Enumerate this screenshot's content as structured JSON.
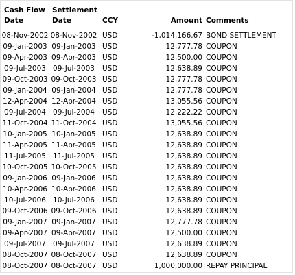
{
  "headers": {
    "cash_flow_date": [
      "Cash Flow",
      "Date"
    ],
    "settlement_date": [
      "Settlement",
      "Date"
    ],
    "ccy": "CCY",
    "amount": "Amount",
    "comments": "Comments"
  },
  "rows": [
    {
      "cf_date": "08-Nov-2002",
      "settle_date": "08-Nov-2002",
      "ccy": "USD",
      "amount": "-1,014,166.67",
      "comment": "BOND SETTLEMENT"
    },
    {
      "cf_date": "09-Jan-2003",
      "settle_date": "09-Jan-2003",
      "ccy": "USD",
      "amount": "12,777.78",
      "comment": "COUPON"
    },
    {
      "cf_date": "09-Apr-2003",
      "settle_date": "09-Apr-2003",
      "ccy": "USD",
      "amount": "12,500.00",
      "comment": "COUPON"
    },
    {
      "cf_date": "09-Jul-2003",
      "settle_date": "09-Jul-2003",
      "ccy": "USD",
      "amount": "12,638.89",
      "comment": "COUPON"
    },
    {
      "cf_date": "09-Oct-2003",
      "settle_date": "09-Oct-2003",
      "ccy": "USD",
      "amount": "12,777.78",
      "comment": "COUPON"
    },
    {
      "cf_date": "09-Jan-2004",
      "settle_date": "09-Jan-2004",
      "ccy": "USD",
      "amount": "12,777.78",
      "comment": "COUPON"
    },
    {
      "cf_date": "12-Apr-2004",
      "settle_date": "12-Apr-2004",
      "ccy": "USD",
      "amount": "13,055.56",
      "comment": "COUPON"
    },
    {
      "cf_date": "09-Jul-2004",
      "settle_date": "09-Jul-2004",
      "ccy": "USD",
      "amount": "12,222.22",
      "comment": "COUPON"
    },
    {
      "cf_date": "11-Oct-2004",
      "settle_date": "11-Oct-2004",
      "ccy": "USD",
      "amount": "13,055.56",
      "comment": "COUPON"
    },
    {
      "cf_date": "10-Jan-2005",
      "settle_date": "10-Jan-2005",
      "ccy": "USD",
      "amount": "12,638.89",
      "comment": "COUPON"
    },
    {
      "cf_date": "11-Apr-2005",
      "settle_date": "11-Apr-2005",
      "ccy": "USD",
      "amount": "12,638.89",
      "comment": "COUPON"
    },
    {
      "cf_date": "11-Jul-2005",
      "settle_date": "11-Jul-2005",
      "ccy": "USD",
      "amount": "12,638.89",
      "comment": "COUPON"
    },
    {
      "cf_date": "10-Oct-2005",
      "settle_date": "10-Oct-2005",
      "ccy": "USD",
      "amount": "12,638.89",
      "comment": "COUPON"
    },
    {
      "cf_date": "09-Jan-2006",
      "settle_date": "09-Jan-2006",
      "ccy": "USD",
      "amount": "12,638.89",
      "comment": "COUPON"
    },
    {
      "cf_date": "10-Apr-2006",
      "settle_date": "10-Apr-2006",
      "ccy": "USD",
      "amount": "12,638.89",
      "comment": "COUPON"
    },
    {
      "cf_date": "10-Jul-2006",
      "settle_date": "10-Jul-2006",
      "ccy": "USD",
      "amount": "12,638.89",
      "comment": "COUPON"
    },
    {
      "cf_date": "09-Oct-2006",
      "settle_date": "09-Oct-2006",
      "ccy": "USD",
      "amount": "12,638.89",
      "comment": "COUPON"
    },
    {
      "cf_date": "09-Jan-2007",
      "settle_date": "09-Jan-2007",
      "ccy": "USD",
      "amount": "12,777.78",
      "comment": "COUPON"
    },
    {
      "cf_date": "09-Apr-2007",
      "settle_date": "09-Apr-2007",
      "ccy": "USD",
      "amount": "12,500.00",
      "comment": "COUPON"
    },
    {
      "cf_date": "09-Jul-2007",
      "settle_date": "09-Jul-2007",
      "ccy": "USD",
      "amount": "12,638.89",
      "comment": "COUPON"
    },
    {
      "cf_date": "08-Oct-2007",
      "settle_date": "08-Oct-2007",
      "ccy": "USD",
      "amount": "12,638.89",
      "comment": "COUPON"
    },
    {
      "cf_date": "08-Oct-2007",
      "settle_date": "08-Oct-2007",
      "ccy": "USD",
      "amount": "1,000,000.00",
      "comment": "REPAY PRINCIPAL"
    }
  ]
}
